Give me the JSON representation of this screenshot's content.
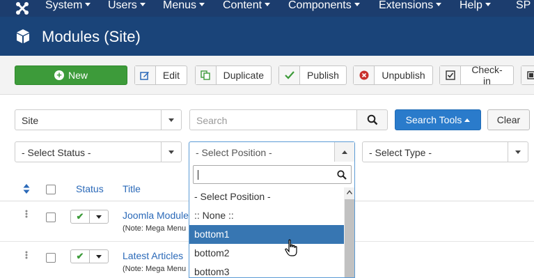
{
  "topnav": {
    "items": [
      {
        "label": "System"
      },
      {
        "label": "Users"
      },
      {
        "label": "Menus"
      },
      {
        "label": "Content"
      },
      {
        "label": "Components"
      },
      {
        "label": "Extensions"
      },
      {
        "label": "Help"
      },
      {
        "label": "SP"
      }
    ]
  },
  "header": {
    "title": "Modules (Site)"
  },
  "toolbar": {
    "new_label": "New",
    "edit_label": "Edit",
    "duplicate_label": "Duplicate",
    "publish_label": "Publish",
    "unpublish_label": "Unpublish",
    "checkin_label": "Check-in"
  },
  "filters": {
    "client_value": "Site",
    "search_placeholder": "Search",
    "search_tools_label": "Search Tools",
    "clear_label": "Clear",
    "status_value": "- Select Status -",
    "position_value": "- Select Position -",
    "type_value": "- Select Type -"
  },
  "table": {
    "headers": {
      "status": "Status",
      "title": "Title"
    },
    "rows": [
      {
        "title": "Joomla Module",
        "note": "(Note: Mega Menu"
      },
      {
        "title": "Latest Articles",
        "note": "(Note: Mega Menu"
      }
    ]
  },
  "position_dropdown": {
    "search_value": "",
    "items": [
      {
        "label": "- Select Position -"
      },
      {
        "label": ":: None ::"
      },
      {
        "label": "bottom1"
      },
      {
        "label": "bottom2"
      },
      {
        "label": "bottom3"
      }
    ],
    "highlighted": "bottom1"
  },
  "colors": {
    "topnav_bg": "#1c3d6e",
    "header_bg": "#1a4479",
    "new_button": "#3d9b3a",
    "search_tools_button": "#2a7bcb",
    "dropdown_highlight": "#3776b2",
    "link": "#2a69b8"
  }
}
